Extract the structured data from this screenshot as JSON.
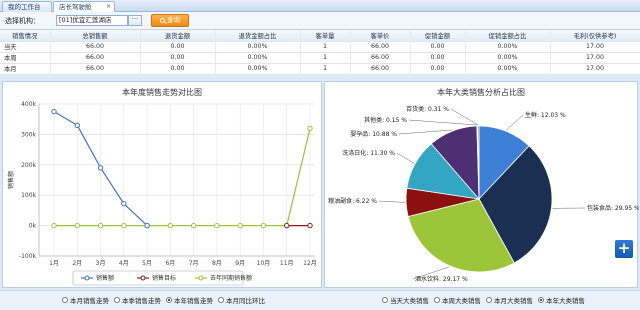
{
  "tabs": [
    {
      "label": "我的工作台"
    },
    {
      "label": "店长驾驶舱"
    }
  ],
  "toolbar": {
    "org_label": "选择机构：",
    "org_value": "[01]优宜汇莲湖店",
    "browse_label": "···",
    "search_label": "查询"
  },
  "table": {
    "headers": [
      "销售情况",
      "总销售额",
      "退货金额",
      "退货金额占比",
      "客单量",
      "客单价",
      "促销金额",
      "促销金额占比",
      "毛利(仅供参考)"
    ],
    "rows": [
      [
        "当天",
        "66.00",
        "0.00",
        "0.00%",
        "1",
        "66.00",
        "0.00",
        "0.00%",
        "17.00"
      ],
      [
        "本周",
        "66.00",
        "0.00",
        "0.00%",
        "1",
        "66.00",
        "0.00",
        "0.00%",
        "17.00"
      ],
      [
        "本月",
        "66.00",
        "0.00",
        "0.00%",
        "1",
        "66.00",
        "0.00",
        "0.00%",
        "17.00"
      ]
    ]
  },
  "chart_data": [
    {
      "type": "line",
      "title": "本年度销售走势对比图",
      "xlabel": "",
      "ylabel": "销售额",
      "categories": [
        "1月",
        "2月",
        "3月",
        "4月",
        "5月",
        "6月",
        "7月",
        "8月",
        "9月",
        "10月",
        "11月",
        "12月"
      ],
      "ytick_labels": [
        "-100k",
        "0k",
        "100k",
        "200k",
        "300k",
        "400k"
      ],
      "ylim": [
        -100000,
        400000
      ],
      "series": [
        {
          "name": "销售额",
          "color": "#4472c4",
          "values": [
            375000,
            330000,
            190000,
            72000,
            0,
            null,
            null,
            null,
            null,
            null,
            null,
            null
          ]
        },
        {
          "name": "销售目标",
          "color": "#8b1a1a",
          "values": [
            null,
            null,
            null,
            null,
            null,
            null,
            null,
            null,
            null,
            null,
            0,
            0
          ]
        },
        {
          "name": "去年同期销售额",
          "color": "#9bc33b",
          "values": [
            0,
            0,
            0,
            0,
            0,
            0,
            0,
            0,
            0,
            0,
            0,
            320000
          ]
        }
      ],
      "grid": true,
      "legend": "bottom"
    },
    {
      "type": "pie",
      "title": "本年大类销售分析占比图",
      "slices": [
        {
          "label": "生鲜",
          "value": 12.03,
          "text": "生鲜: 12.03 %",
          "color": "#3d7fd6"
        },
        {
          "label": "包装食品",
          "value": 29.95,
          "text": "包装食品: 29.95 %",
          "color": "#1b2f52"
        },
        {
          "label": "酒水饮料",
          "value": 29.17,
          "text": "酒水饮料: 29.17 %",
          "color": "#9cc53a"
        },
        {
          "label": "粮油副食",
          "value": 6.22,
          "text": "粮油副食: 6.22 %",
          "color": "#8b1010"
        },
        {
          "label": "洗涤日化",
          "value": 11.3,
          "text": "洗涤日化: 11.30 %",
          "color": "#33a6c4"
        },
        {
          "label": "婴孕品",
          "value": 10.88,
          "text": "婴孕品: 10.88 %",
          "color": "#4d2f73"
        },
        {
          "label": "其他类",
          "value": 0.15,
          "text": "其他类: 0.15 %",
          "color": "#c55a11"
        },
        {
          "label": "百货类",
          "value": 0.31,
          "text": "百货类: 0.31 %",
          "color": "#7f7f7f"
        }
      ]
    }
  ],
  "bottom_left_options": [
    {
      "label": "本月销售走势",
      "checked": false
    },
    {
      "label": "本季销售走势",
      "checked": false
    },
    {
      "label": "本年销售走势",
      "checked": true
    },
    {
      "label": "本月同比环比",
      "checked": false
    }
  ],
  "bottom_right_options": [
    {
      "label": "当天大类销售",
      "checked": false
    },
    {
      "label": "本周大类销售",
      "checked": false
    },
    {
      "label": "本月大类销售",
      "checked": false
    },
    {
      "label": "本年大类销售",
      "checked": true
    }
  ],
  "plus_label": "+"
}
